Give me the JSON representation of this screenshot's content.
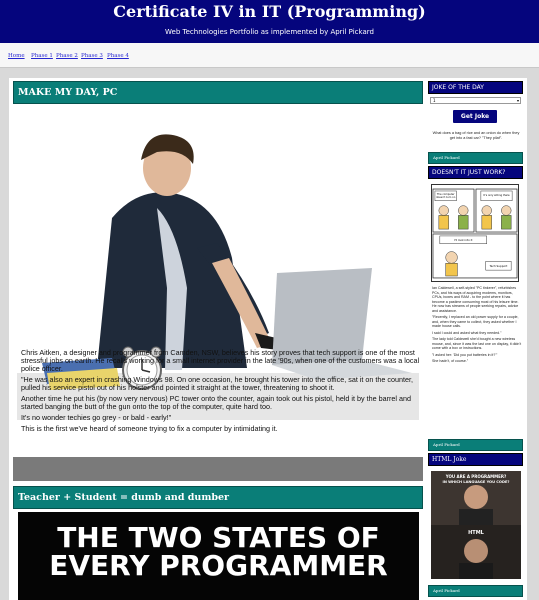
{
  "header": {
    "title": "Certificate IV in IT (Programming)",
    "subtitle": "Web Technologies Portfolio as implemented by April Pickard"
  },
  "nav": {
    "items": [
      "Home",
      "Phase 1",
      "Phase 2",
      "Phase 3",
      "Phase 4"
    ]
  },
  "main": {
    "section1_title": "MAKE MY DAY, PC",
    "paragraphs": [
      "Chris Aitken, a designer and programmer from Camden, NSW, believes his story proves that tech support is one of the most stressful jobs on earth. He recalls working for a small internet provider in the late '90s, when one of the customers was a local police officer.",
      "\"He was also an expert in crashing Windows 98. On one occasion, he brought his tower into the office, sat it on the counter, pulled his service pistol out of his holster and pointed it straight at the tower, threatening to shoot it.",
      "Another time he put his (by now very nervous) PC tower onto the counter, again took out his pistol, held it by the barrel and started banging the butt of the gun onto the top of the computer, quite hard too.",
      "It's no wonder techies go grey - or bald - early!\"",
      "This is the first we've heard of someone trying to fix a computer by intimidating it."
    ],
    "section2_title": "Teacher + Student = dumb and dumber",
    "meme_text_line1": "THE TWO STATES OF",
    "meme_text_line2": "EVERY PROGRAMMER"
  },
  "sidebar": {
    "joke_title": "JOKE OF THE DAY",
    "select_value": "1",
    "joke_button": "Get Joke",
    "joke_text": "What does a bag of rice and an onion do when they get into a fast car? \"They pilaf\".",
    "footer_label": "April Pickard",
    "comic_title": "DOESN'T IT JUST WORK?",
    "comic_caption_1": "The computer doesn't turn on.",
    "comic_caption_2": "It's only sitting there.",
    "comic_caption_3": "I'll look into it.",
    "comic_caption_4": "Tech Support",
    "story_paragraphs": [
      "Ian Caldewell, a self-styled \"PC tinkerer\", refurbishes PCs, and his ways of acquiring modems, monitors, CPUs, boxes and RAM - to the point where it has become a pastime consuming most of his leisure time. He now has streams of people seeking repairs, advice and assistance.",
      "\"Recently, I replaced an old power supply for a couple, and, when they came to collect, they asked whether I made house calls.",
      "I said I could and asked what they needed.\"",
      "The lady told Caldewell she'd bought a new wireless mouse, and, since it was the last one on display, it didn't come with a box or instructions.",
      "\"I asked her: 'Did you put batteries in it?'\"",
      "She hadn't, of course.\""
    ],
    "html_joke_title": "HTML Joke",
    "meme2_top": "YOU ARE A PROGRAMMER? IN WHICH LANGUAGE YOU CODE?",
    "meme2_bottom": "HTML"
  }
}
